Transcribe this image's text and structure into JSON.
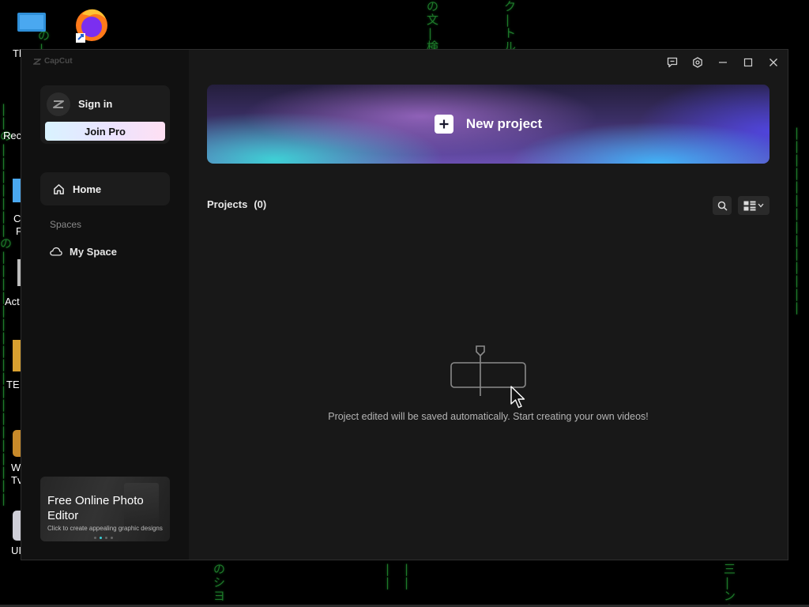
{
  "desktop": {
    "icons": [
      {
        "name": "this-pc",
        "label": "Th"
      },
      {
        "name": "firefox",
        "label": ""
      }
    ],
    "side_labels": [
      "Rec",
      "C",
      "F",
      "Act",
      "TE",
      "W",
      "Tv",
      "UI"
    ],
    "matrix_glyphs": [
      "の",
      "文",
      "ト",
      "ル",
      "の",
      "シ",
      "ヨ",
      "三",
      "ン",
      "ム"
    ]
  },
  "app": {
    "logo_text": "CapCut",
    "title_controls": [
      "feedback-icon",
      "settings-icon",
      "minimize-icon",
      "maximize-icon",
      "close-icon"
    ]
  },
  "sidebar": {
    "sign_in": "Sign in",
    "join_pro": "Join Pro",
    "home": "Home",
    "spaces_heading": "Spaces",
    "my_space": "My Space",
    "promo": {
      "title": "Free Online Photo Editor",
      "subtitle": "Click to create appealing graphic designs"
    }
  },
  "main": {
    "new_project": "New project",
    "projects_label": "Projects",
    "projects_count": "(0)",
    "empty_message": "Project edited will be saved automatically. Start creating your own videos!"
  },
  "colors": {
    "window_bg": "#181818",
    "sidebar_bg": "#111111",
    "accent_teal": "#3ad0d8",
    "accent_purple": "#6a4fb0"
  }
}
